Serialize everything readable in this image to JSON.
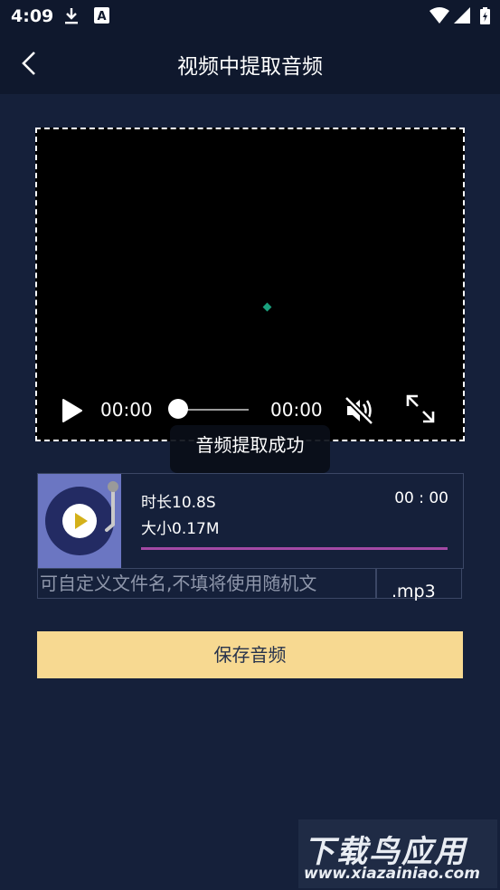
{
  "status_bar": {
    "time": "4:09",
    "icons": [
      "download-icon",
      "a-badge-icon",
      "wifi-icon",
      "signal-icon",
      "battery-icon"
    ]
  },
  "app_bar": {
    "title": "视频中提取音频",
    "back_icon": "chevron-left-icon"
  },
  "video_player": {
    "current_time": "00:00",
    "total_time": "00:00",
    "progress": 0,
    "muted": true
  },
  "toast": {
    "message": "音频提取成功"
  },
  "audio_item": {
    "duration_label": "时长10.8S",
    "size_label": "大小0.17M",
    "play_time": "00 : 00",
    "progress": 0
  },
  "filename": {
    "placeholder": "可自定义文件名,不填将使用随机文",
    "value": "",
    "extension": ".mp3"
  },
  "save_button": {
    "label": "保存音频"
  },
  "watermark": {
    "line1": "下载鸟应用",
    "line2": "www.xiazainiao.com"
  },
  "colors": {
    "background": "#15203a",
    "app_bar": "#0f182d",
    "save_button": "#f7d991",
    "progress_accent": "#a349a4",
    "thumb": "#6b76c2"
  }
}
